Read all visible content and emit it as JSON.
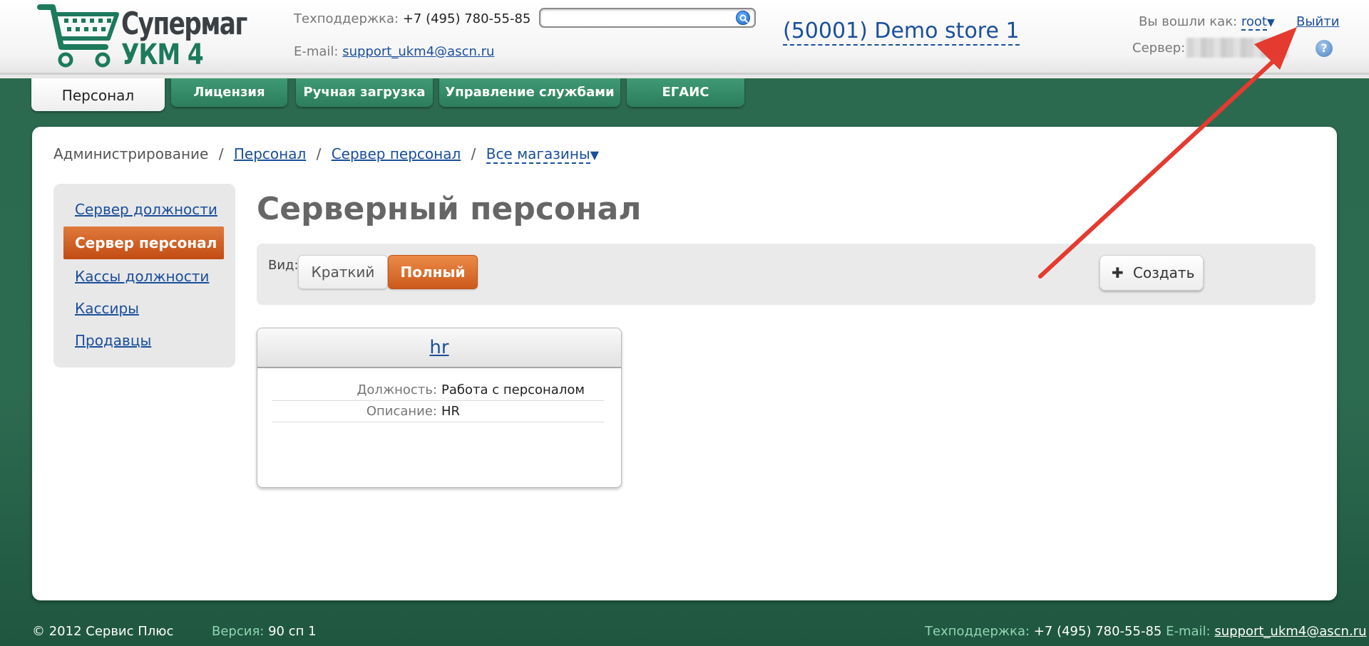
{
  "header": {
    "logo": {
      "line1": "Супермаг",
      "line2": "УКМ 4"
    },
    "support_label": "Техподдержка:",
    "support_phone": "+7 (495) 780-55-85",
    "email_label": "E-mail:",
    "email": "support_ukm4@ascn.ru",
    "search": {
      "value": "",
      "placeholder": ""
    },
    "store": "(50001) Demo store 1",
    "logged_in_label": "Вы вошли как:",
    "user": "root",
    "logout": "Выйти",
    "server_label": "Сервер:",
    "help": "?"
  },
  "tabs": [
    {
      "label": "Персонал",
      "active": true
    },
    {
      "label": "Лицензия",
      "active": false
    },
    {
      "label": "Ручная загрузка",
      "active": false
    },
    {
      "label": "Управление службами",
      "active": false
    },
    {
      "label": "ЕГАИС",
      "active": false
    }
  ],
  "breadcrumb": {
    "root": "Администрирование",
    "sep": "/",
    "items": [
      "Персонал",
      "Сервер персонал"
    ],
    "dropdown": "Все магазины"
  },
  "sidebar": {
    "items": [
      {
        "label": "Сервер должности",
        "active": false
      },
      {
        "label": "Сервер персонал",
        "active": true
      },
      {
        "label": "Кассы должности",
        "active": false
      },
      {
        "label": "Кассиры",
        "active": false
      },
      {
        "label": "Продавцы",
        "active": false
      }
    ]
  },
  "page": {
    "title": "Серверный персонал",
    "view_label": "Вид:",
    "view_options": [
      {
        "label": "Краткий",
        "active": false
      },
      {
        "label": "Полный",
        "active": true
      }
    ],
    "create_label": "Создать"
  },
  "cards": [
    {
      "title": "hr",
      "fields": [
        {
          "key": "Должность:",
          "value": "Работа с персоналом"
        },
        {
          "key": "Описание:",
          "value": "HR"
        }
      ]
    }
  ],
  "footer": {
    "copyright": "© 2012 Сервис Плюс",
    "version_label": "Версия:",
    "version": "90 сп 1",
    "support_label": "Техподдержка:",
    "support_phone": "+7 (495) 780-55-85",
    "email_label": "E-mail:",
    "email": "support_ukm4@ascn.ru"
  },
  "colors": {
    "brand_green": "#2c6a50",
    "accent_orange": "#cc5a1c",
    "link_blue": "#1a4f9a",
    "annotation_arrow": "#e53a2f"
  }
}
